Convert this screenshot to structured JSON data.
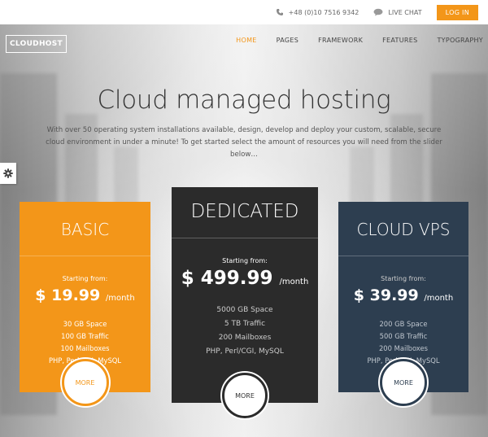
{
  "topbar": {
    "phone": "+48 (0)10 7516 9342",
    "phone_icon": "phone-icon",
    "chat": "LIVE CHAT",
    "chat_icon": "chat-bubble-icon",
    "login": "LOG IN"
  },
  "brand": {
    "logo": "CLOUDHOST"
  },
  "nav": {
    "items": [
      "HOME",
      "PAGES",
      "FRAMEWORK",
      "FEATURES",
      "TYPOGRAPHY"
    ],
    "active": "HOME"
  },
  "hero": {
    "headline": "Cloud managed hosting",
    "intro": "With over 50 operating system installations available, design, develop and deploy your custom, scalable, secure cloud environment in under a minute! To get started select the amount of resources you will need from the slider below…"
  },
  "settings": {
    "icon": "gear-icon"
  },
  "plans": {
    "basic": {
      "title": "BASIC",
      "starting": "Starting from:",
      "price": "$ 19.99",
      "per": "/month",
      "features": [
        "30 GB Space",
        "100 GB Traffic",
        "100 Mailboxes",
        "PHP, Perl/CGI, MySQL"
      ],
      "button": "MORE"
    },
    "dedicated": {
      "title": "DEDICATED",
      "starting": "Starting from:",
      "price": "$ 499.99",
      "per": "/month",
      "features": [
        "5000 GB Space",
        "5 TB Traffic",
        "200 Mailboxes",
        "PHP, Perl/CGI, MySQL"
      ],
      "button": "MORE"
    },
    "cloud": {
      "title": "CLOUD VPS",
      "starting": "Starting from:",
      "price": "$ 39.99",
      "per": "/month",
      "features": [
        "200 GB Space",
        "500 GB Traffic",
        "200 Mailboxes",
        "PHP, Perl/CGI, MySQL"
      ],
      "button": "MORE"
    }
  },
  "colors": {
    "accent": "#f39619",
    "dark_card": "#2b2b2b",
    "blue_card": "#2d3e50"
  }
}
